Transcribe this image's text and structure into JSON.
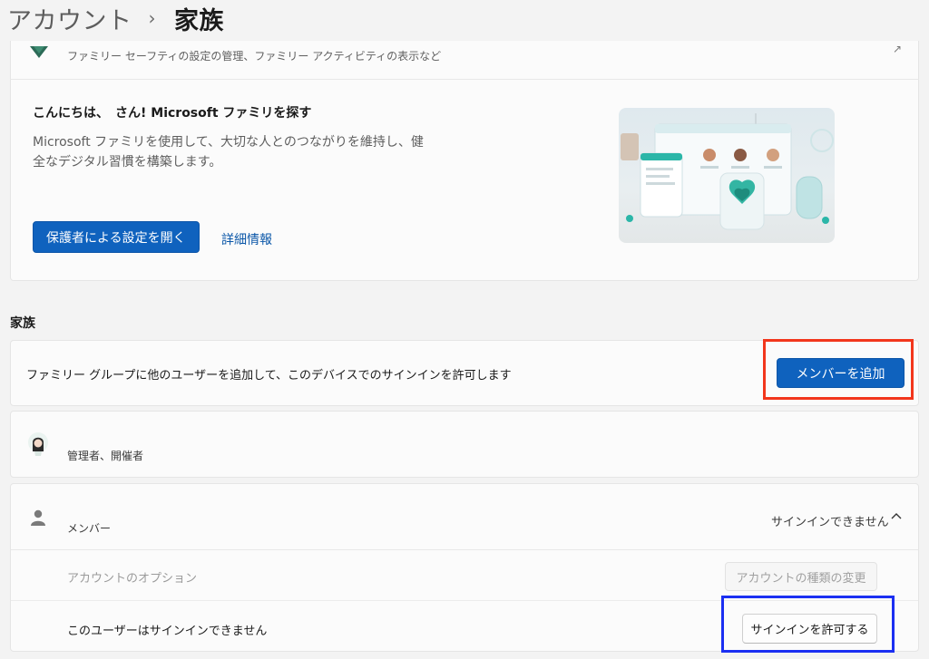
{
  "breadcrumb": {
    "root": "アカウント",
    "separator": "›",
    "current": "家族"
  },
  "family_safety": {
    "subtitle": "ファミリー セーフティの設定の管理、ファミリー アクティビティの表示など"
  },
  "promo": {
    "heading": "こんにちは、　さん! Microsoft ファミリを探す",
    "description": "Microsoft ファミリを使用して、大切な人とのつながりを維持し、健全なデジタル習慣を構築します。",
    "open_button": "保護者による設定を開く",
    "details_link": "詳細情報"
  },
  "family_section": {
    "label": "家族",
    "add_text": "ファミリー グループに他のユーザーを追加して、このデバイスでのサインインを許可します",
    "add_button": "メンバーを追加"
  },
  "members": [
    {
      "role": "管理者、開催者"
    },
    {
      "role": "メンバー",
      "status": "サインインできません",
      "options_label": "アカウントのオプション",
      "change_type_button": "アカウントの種類の変更",
      "signin_label": "このユーザーはサインインできません",
      "allow_signin_button": "サインインを許可する"
    }
  ],
  "colors": {
    "accent": "#0f62be",
    "highlight_red": "#f2361c",
    "highlight_blue": "#1b2ff2"
  }
}
